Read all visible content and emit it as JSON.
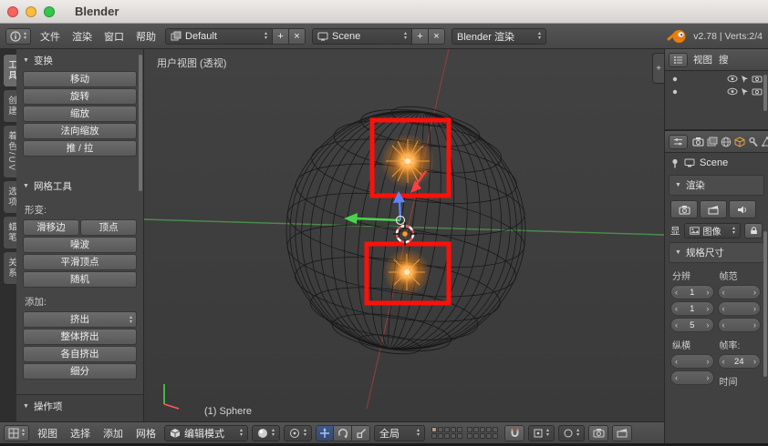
{
  "window": {
    "title": "Blender"
  },
  "infobar": {
    "menus": [
      "文件",
      "渲染",
      "窗口",
      "帮助"
    ],
    "layout_value": "Default",
    "scene_value": "Scene",
    "engine_value": "Blender 渲染",
    "stats": "v2.78 | Verts:2/4"
  },
  "left_tabs": [
    "工具",
    "创建",
    "着色/UV",
    "选项",
    "蜡笔",
    "关系"
  ],
  "shelf": {
    "transform_title": "变换",
    "transform_buttons": [
      "移动",
      "旋转",
      "缩放",
      "法向缩放",
      "推 / 拉"
    ],
    "meshtools_title": "网格工具",
    "deform_label": "形变:",
    "slide_edge": "滑移边",
    "vertex": "顶点",
    "noise": "噪波",
    "smooth": "平滑顶点",
    "random": "随机",
    "add_label": "添加:",
    "extrude": "挤出",
    "extrude_region": "整体挤出",
    "extrude_indiv": "各自挤出",
    "subdivide": "细分",
    "operator_title": "操作项"
  },
  "viewport": {
    "view_label": "用户视图 (透视)",
    "object_label": "(1) Sphere"
  },
  "vheader": {
    "menus": [
      "视图",
      "选择",
      "添加",
      "网格"
    ],
    "mode": "编辑模式",
    "orientation": "全局"
  },
  "outliner": {
    "menu_view": "视图",
    "menu_search": "搜"
  },
  "properties": {
    "breadcrumb": "Scene",
    "render_title": "渲染",
    "display_label": "显",
    "display_value": "图像",
    "dims_title": "规格尺寸",
    "res_label": "分辨",
    "frame_label": "帧范",
    "res1": "1",
    "res2": "1",
    "res3": "5",
    "aspect_label": "纵横",
    "fps_label": "帧率:",
    "fps": "24",
    "time_label": "时间"
  },
  "colors": {
    "accent_orange": "#e87d0d",
    "highlight_red": "#ff100a",
    "axis_green": "#4c8b4c"
  }
}
